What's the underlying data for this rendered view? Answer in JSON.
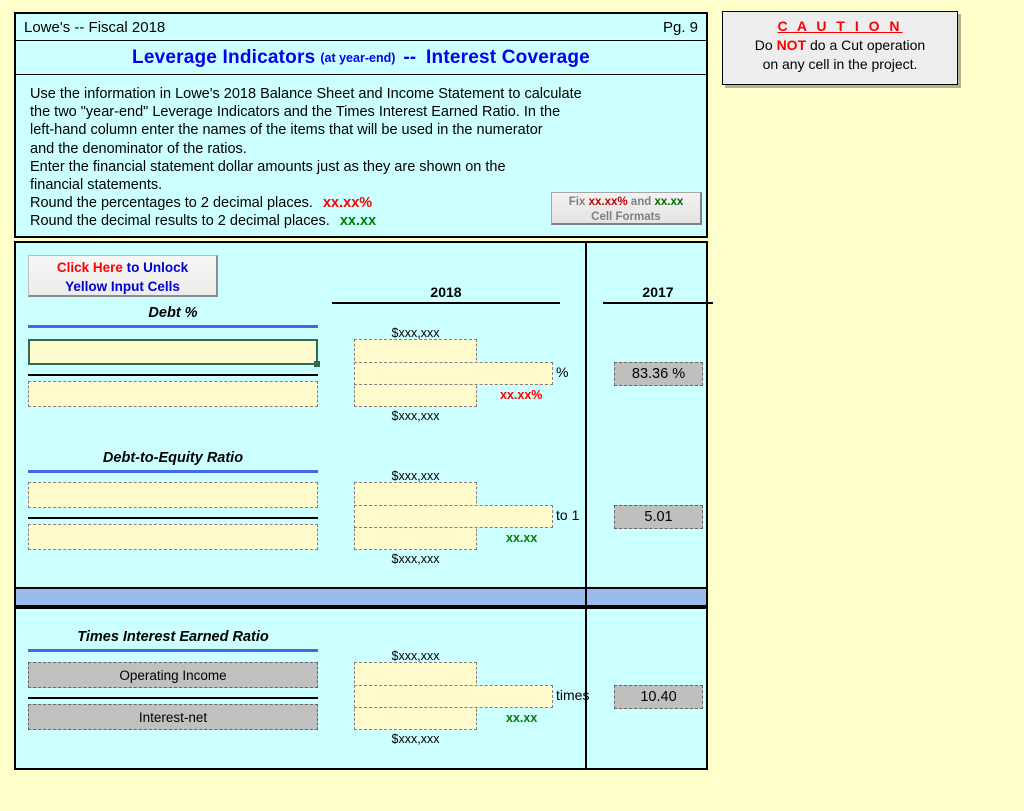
{
  "header": {
    "title": "Lowe's -- Fiscal 2018",
    "page_label": "Pg.  9"
  },
  "title_bar": {
    "main": "Leverage Indicators",
    "sub": "(at year-end)",
    "dash": "--",
    "main2": "Interest Coverage"
  },
  "instructions": {
    "line1": "Use the information in Lowe's 2018 Balance Sheet and Income Statement to calculate",
    "line2": "the two \"year-end\" Leverage Indicators and the Times Interest Earned Ratio.  In the",
    "line3": "left-hand column enter the names of the items that will be used in the numerator",
    "line4": "and the denominator of the ratios.",
    "line5": "Enter the financial statement dollar amounts just as they are shown on the",
    "line6": "financial statements.",
    "line7_text": "Round the percentages to 2 decimal places.",
    "line7_hint": "xx.xx%",
    "line8_text": "Round the decimal results to 2 decimal places.",
    "line8_hint": "xx.xx"
  },
  "fix_button": {
    "word_fix": "Fix",
    "hint_pct": "xx.xx%",
    "word_and": "and",
    "hint_dec": "xx.xx",
    "line2": "Cell Formats"
  },
  "unlock_button": {
    "red": "Click Here",
    "blue1": "to Unlock",
    "blue2": "Yellow Input Cells"
  },
  "columns": {
    "current_year": "2018",
    "prior_year": "2017"
  },
  "ratios": [
    {
      "name": "Debt %",
      "numerator_label": "",
      "denominator_label": "",
      "numerator_hint": "$xxx,xxx",
      "denominator_hint": "$xxx,xxx",
      "result_value": "",
      "unit": "%",
      "format_hint": "xx.xx%",
      "format_hint_color": "red",
      "prior_value": "83.36   %"
    },
    {
      "name": "Debt-to-Equity Ratio",
      "numerator_label": "",
      "denominator_label": "",
      "numerator_hint": "$xxx,xxx",
      "denominator_hint": "$xxx,xxx",
      "result_value": "",
      "unit": "to 1",
      "format_hint": "xx.xx",
      "format_hint_color": "green",
      "prior_value": "5.01"
    },
    {
      "name": "Times Interest Earned Ratio",
      "numerator_label": "Operating Income",
      "denominator_label": "Interest-net",
      "numerator_hint": "$xxx,xxx",
      "denominator_hint": "$xxx,xxx",
      "result_value": "",
      "unit": "times",
      "format_hint": "xx.xx",
      "format_hint_color": "green",
      "prior_value": "10.40"
    }
  ],
  "caution": {
    "title": "C A U T I O N",
    "line2_a": "Do",
    "line2_b": "NOT",
    "line2_c": "do a Cut operation",
    "line3": "on any cell in the project."
  },
  "colors": {
    "sheet_background": "#CCFFFF",
    "page_background": "#FFFFCC",
    "title_blue": "#0000EE",
    "accent_red": "#FF0000",
    "accent_green": "#008000",
    "divider_blue": "#99BBEE",
    "input_yellow": "#FFFBCC",
    "locked_gray": "#C0C0C0"
  }
}
